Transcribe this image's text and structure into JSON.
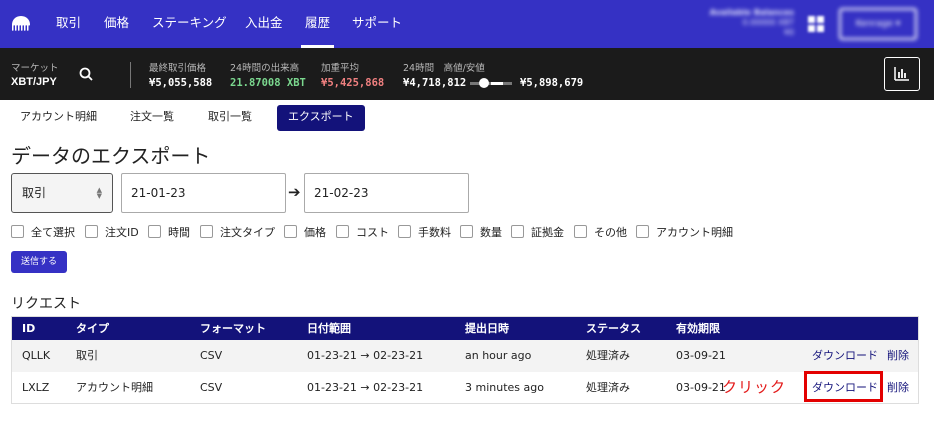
{
  "nav": {
    "items": [
      "取引",
      "価格",
      "ステーキング",
      "入出金",
      "履歴",
      "サポート"
    ],
    "active": "履歴",
    "balance_label": "Available Balances",
    "balance_line1": "0.00000 XBT",
    "balance_line2": "¥0",
    "account_label": "Kenrage ▾"
  },
  "ticker": {
    "market_label": "マーケット",
    "pair": "XBT/JPY",
    "last_price_label": "最終取引価格",
    "last_price": "¥5,055,588",
    "volume_label": "24時間の出来高",
    "volume": "21.87008 XBT",
    "wavg_label": "加重平均",
    "wavg": "¥5,425,868",
    "range_label": "24時間　高値/安値",
    "low": "¥4,718,812",
    "high": "¥5,898,679",
    "colors": {
      "last": "#ffffff",
      "volume": "#7bd88f",
      "wavg": "#f08080"
    }
  },
  "subtabs": [
    "アカウント明細",
    "注文一覧",
    "取引一覧",
    "エクスポート"
  ],
  "subtab_active": "エクスポート",
  "page_title": "データのエクスポート",
  "form": {
    "type_value": "取引",
    "date_from": "21-01-23",
    "date_to": "21-02-23",
    "checkboxes": [
      "全て選択",
      "注文ID",
      "時間",
      "注文タイプ",
      "価格",
      "コスト",
      "手数料",
      "数量",
      "証拠金",
      "その他",
      "アカウント明細"
    ],
    "submit_label": "送信する"
  },
  "requests": {
    "title": "リクエスト",
    "columns": [
      "ID",
      "タイプ",
      "フォーマット",
      "日付範囲",
      "提出日時",
      "ステータス",
      "有効期限"
    ],
    "rows": [
      {
        "id": "QLLK",
        "type": "取引",
        "format": "CSV",
        "range": "01-23-21 → 02-23-21",
        "submitted": "an hour ago",
        "status": "処理済み",
        "expires": "03-09-21",
        "download": "ダウンロード",
        "delete": "削除"
      },
      {
        "id": "LXLZ",
        "type": "アカウント明細",
        "format": "CSV",
        "range": "01-23-21 → 02-23-21",
        "submitted": "3 minutes ago",
        "status": "処理済み",
        "expires": "03-09-21",
        "download": "ダウンロード",
        "delete": "削除"
      }
    ]
  },
  "annotation": {
    "text": "クリック",
    "color": "#e31b1b"
  },
  "colors": {
    "brand": "#3531c4",
    "navy": "#13127a",
    "ticker_bg": "#1b1b1b"
  }
}
